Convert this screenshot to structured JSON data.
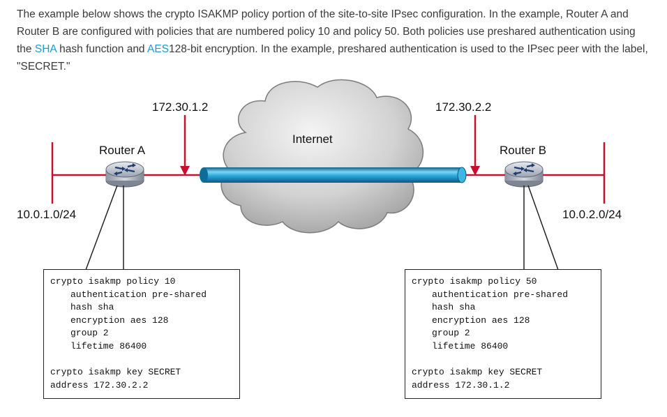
{
  "intro": {
    "part1": "The example below shows the crypto ISAKMP policy portion of the site-to-site IPsec configuration. In the example, Router A and Router B are configured with policies that are numbered policy 10 and policy 50. Both policies use preshared authentication using the ",
    "link_sha": "SHA",
    "part2": " hash function and ",
    "link_aes": "AES",
    "part3": "128-bit encryption. In the example, preshared authentication is used to the IPsec peer with the label, \"SECRET.\""
  },
  "diagram": {
    "cloud_label": "Internet",
    "router_a": {
      "name": "Router A",
      "peer_ip": "172.30.1.2",
      "lan": "10.0.1.0/24"
    },
    "router_b": {
      "name": "Router B",
      "peer_ip": "172.30.2.2",
      "lan": "10.0.2.0/24"
    },
    "config_a": {
      "policy": "crypto isakmp policy 10",
      "auth": "authentication pre-shared",
      "hash": "hash sha",
      "enc": "encryption aes 128",
      "group": "group 2",
      "lifetime": "lifetime 86400",
      "key": "crypto isakmp key SECRET",
      "address": "address 172.30.2.2"
    },
    "config_b": {
      "policy": "crypto isakmp policy 50",
      "auth": "authentication pre-shared",
      "hash": "hash sha",
      "enc": "encryption aes 128",
      "group": "group 2",
      "lifetime": "lifetime 86400",
      "key": "crypto isakmp key SECRET",
      "address": "address 172.30.1.2"
    },
    "colors": {
      "link": "#c8102e",
      "tunnel": "#1aa3d8",
      "cloud": "#cfcfcf",
      "text_link": "#1a9ad6"
    }
  }
}
